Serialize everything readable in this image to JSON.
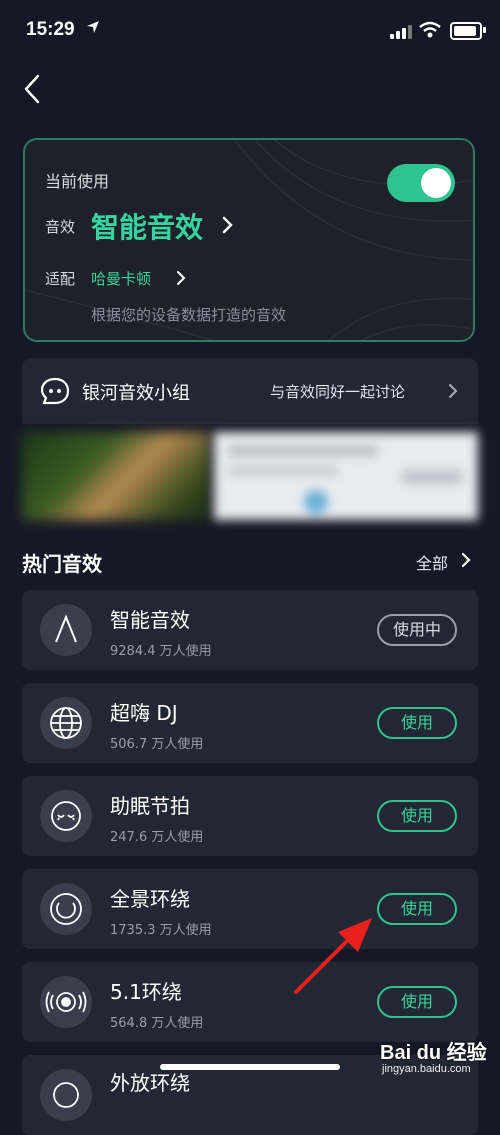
{
  "status_bar": {
    "time": "15:29"
  },
  "current": {
    "label": "当前使用",
    "effect_label": "音效",
    "effect_name": "智能音效",
    "fit_label": "适配",
    "fit_value": "哈曼卡顿",
    "description": "根据您的设备数据打造的音效",
    "toggle_on": true
  },
  "community": {
    "title": "银河音效小组",
    "link": "与音效同好一起讨论"
  },
  "section": {
    "title": "热门音效",
    "all_label": "全部"
  },
  "effects": [
    {
      "name": "智能音效",
      "count": "9284.4 万人使用",
      "button": "使用中",
      "icon": "letter-a-icon"
    },
    {
      "name": "超嗨 DJ",
      "count": "506.7 万人使用",
      "button": "使用",
      "icon": "globe-icon"
    },
    {
      "name": "助眠节拍",
      "count": "247.6 万人使用",
      "button": "使用",
      "icon": "sleepy-face-icon"
    },
    {
      "name": "全景环绕",
      "count": "1735.3 万人使用",
      "button": "使用",
      "icon": "surround-ring-icon"
    },
    {
      "name": "5.1环绕",
      "count": "564.8 万人使用",
      "button": "使用",
      "icon": "speaker-waves-icon"
    },
    {
      "name": "外放环绕",
      "count": "",
      "button": "",
      "icon": "outdoor-speaker-icon"
    }
  ],
  "watermark": {
    "brand": "Bai du 经验",
    "url": "jingyan.baidu.com"
  },
  "colors": {
    "accent": "#36d49e",
    "background": "#161826",
    "card": "#232633",
    "annotation_arrow": "#e8201e"
  }
}
